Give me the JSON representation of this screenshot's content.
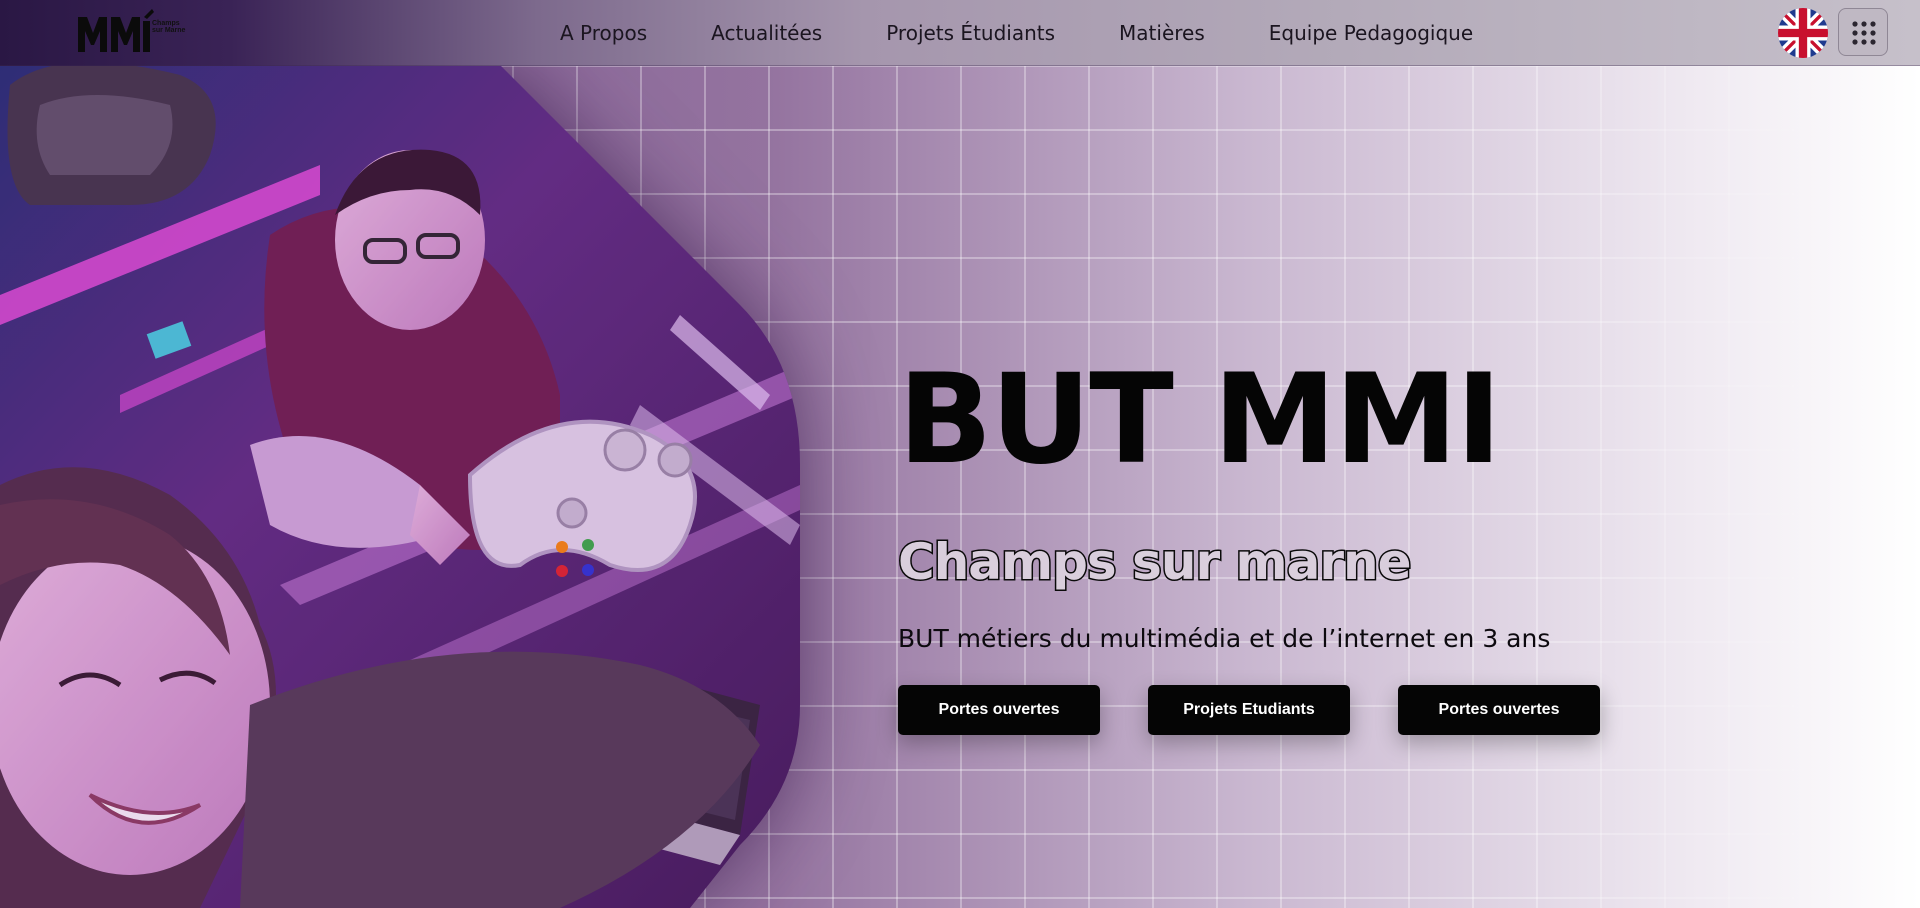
{
  "brand": {
    "logo_tagline": "Champs sur Marne"
  },
  "nav": {
    "links": [
      {
        "label": "A Propos"
      },
      {
        "label": "Actualitées"
      },
      {
        "label": "Projets Étudiants"
      },
      {
        "label": "Matières"
      },
      {
        "label": "Equipe Pedagogique"
      }
    ],
    "language_icon": "uk-flag-icon",
    "menu_icon": "grid-menu-icon"
  },
  "hero": {
    "title": "BUT MMI",
    "subtitle": "Champs sur marne",
    "description": "BUT métiers du multimédia et de l’internet en 3 ans",
    "buttons": [
      {
        "label": "Portes ouvertes"
      },
      {
        "label": "Projets Etudiants"
      },
      {
        "label": "Portes ouvertes"
      }
    ]
  },
  "colors": {
    "accent_pink": "#e14bd8",
    "button_bg": "#050505",
    "background_purple": "#94739f"
  }
}
